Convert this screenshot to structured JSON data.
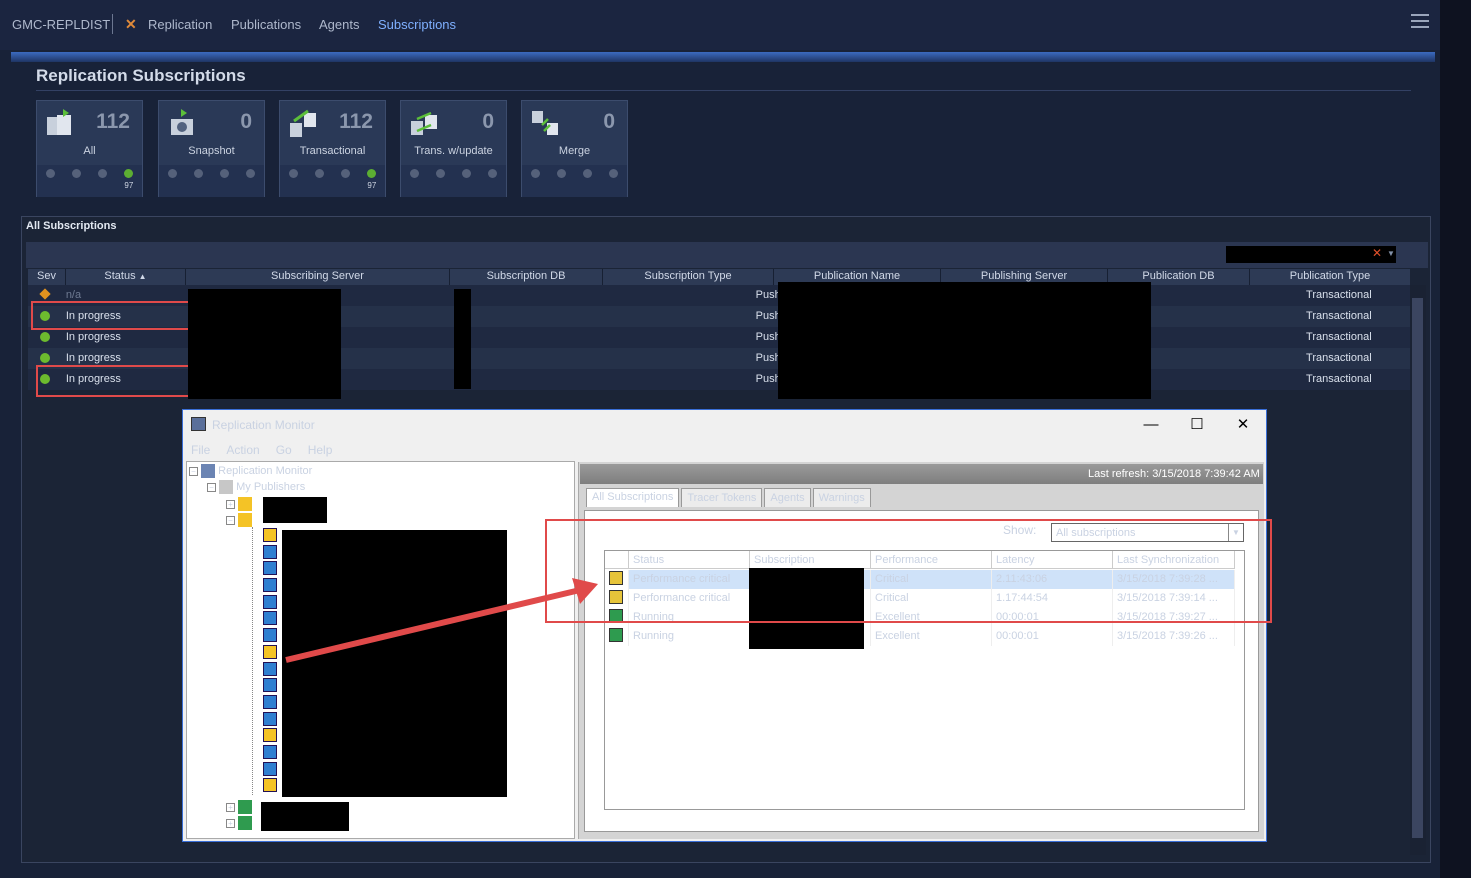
{
  "app": {
    "server": "GMC-REPLDIST",
    "nav": [
      "Replication",
      "Publications",
      "Agents",
      "Subscriptions"
    ],
    "active_nav": "Subscriptions"
  },
  "page_title": "Replication Subscriptions",
  "cards": [
    {
      "label": "All",
      "count": "112",
      "ok": "97"
    },
    {
      "label": "Snapshot",
      "count": "0",
      "ok": "0"
    },
    {
      "label": "Transactional",
      "count": "112",
      "ok": "97"
    },
    {
      "label": "Trans. w/update",
      "count": "0",
      "ok": "0"
    },
    {
      "label": "Merge",
      "count": "0",
      "ok": "0"
    }
  ],
  "grid": {
    "title": "All Subscriptions",
    "columns": [
      "Sev",
      "Status",
      "Subscribing Server",
      "Subscription DB",
      "Subscription Type",
      "Publication Name",
      "Publishing Server",
      "Publication DB",
      "Publication Type"
    ],
    "sort_indicator": "▲",
    "rows": [
      {
        "sev": "warning",
        "status": "n/a",
        "sub_type": "Push",
        "pub_type": "Transactional"
      },
      {
        "sev": "ok",
        "status": "In progress",
        "sub_type": "Push",
        "pub_type": "Transactional"
      },
      {
        "sev": "ok",
        "status": "In progress",
        "sub_type": "Push",
        "pub_type": "Transactional"
      },
      {
        "sev": "ok",
        "status": "In progress",
        "sub_type": "Push",
        "pub_type": "Transactional"
      },
      {
        "sev": "ok",
        "status": "In progress",
        "sub_type": "Push",
        "pub_type": "Transactional"
      }
    ]
  },
  "monitor": {
    "title": "Replication Monitor",
    "menu": [
      "File",
      "Action",
      "Go",
      "Help"
    ],
    "tree_root": "Replication Monitor",
    "tree_publishers": "My Publishers",
    "last_refresh": "Last refresh: 3/15/2018 7:39:42 AM",
    "tabs": [
      "All Subscriptions",
      "Tracer Tokens",
      "Agents",
      "Warnings"
    ],
    "show_label": "Show:",
    "show_value": "All subscriptions",
    "list_columns": [
      "Status",
      "Subscription",
      "Performance",
      "Latency",
      "Last Synchronization"
    ],
    "list_rows": [
      {
        "status": "Performance critical",
        "performance": "Critical",
        "latency": "2.11:43:06",
        "last_sync": "3/15/2018 7:39:28 ..."
      },
      {
        "status": "Performance critical",
        "performance": "Critical",
        "latency": "1.17:44:54",
        "last_sync": "3/15/2018 7:39:14 ..."
      },
      {
        "status": "Running",
        "performance": "Excellent",
        "latency": "00:00:01",
        "last_sync": "3/15/2018 7:39:27 ..."
      },
      {
        "status": "Running",
        "performance": "Excellent",
        "latency": "00:00:01",
        "last_sync": "3/15/2018 7:39:26 ..."
      }
    ]
  },
  "colors": {
    "accent": "#7fb0ff",
    "annotation": "#e04a4a",
    "ok": "#6dbb2e",
    "warning": "#e0921f"
  }
}
